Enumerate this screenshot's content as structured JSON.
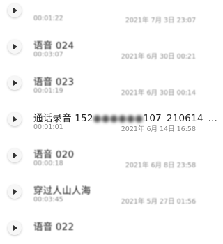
{
  "recordings": [
    {
      "title": "",
      "duration": "00:01:22",
      "date": "2021年 7月 3日 23:07",
      "blurred": true
    },
    {
      "title": "语音 024",
      "duration": "00:03:07",
      "date": "2021年 6月 30日 00:21",
      "blurred": true
    },
    {
      "title": "语音 023",
      "duration": "00:01:19",
      "date": "2021年 6月 30日 00:14",
      "blurred": true
    },
    {
      "title_prefix": "通话录音 152",
      "title_masked": "●●●●●●",
      "title_suffix": "107_210614_...",
      "duration": "00:01:01",
      "date": "2021年 6月 14日 16:58",
      "blurred": false
    },
    {
      "title": "语音 020",
      "duration": "00:00:18",
      "date": "2021年 6月 8日 23:58",
      "blurred": true
    },
    {
      "title": "穿过人山人海",
      "duration": "00:03:45",
      "date": "2021年 5月 27日 01:56",
      "blurred": true
    },
    {
      "title": "语音 022",
      "duration": "",
      "date": "",
      "blurred": true
    }
  ],
  "icons": {
    "play": "play-icon"
  }
}
